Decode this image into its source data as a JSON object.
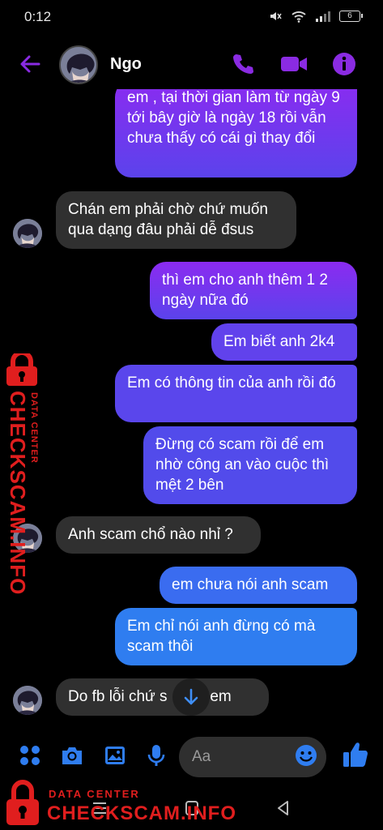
{
  "status_bar": {
    "time": "0:12",
    "battery": "6"
  },
  "header": {
    "contact_name": "Ngo"
  },
  "messages": [
    {
      "from": "me",
      "text": "em , tại thời gian làm từ ngày 9 tới bây giờ là ngày 18 rồi vẫn chưa thấy có cái gì thay đổi"
    },
    {
      "from": "them",
      "text": "Chán em phải chờ chứ muốn qua dạng đâu phải dễ đsus"
    },
    {
      "from": "me",
      "text": "thì em cho anh thêm 1 2 ngày nữa đó"
    },
    {
      "from": "me",
      "text": "Em biết anh 2k4"
    },
    {
      "from": "me",
      "text": "Em có thông tin của anh rồi đó"
    },
    {
      "from": "me",
      "text": "Đừng có scam rồi để em nhờ công an vào cuộc thì mệt 2 bên"
    },
    {
      "from": "them",
      "text": "Anh scam chổ nào nhỉ ?"
    },
    {
      "from": "me",
      "text": "em chưa nói anh scam"
    },
    {
      "from": "me",
      "text": "Em chỉ nói anh đừng có mà scam thôi"
    },
    {
      "from": "them",
      "text": "Do fb lỗi chứ s      gì em"
    }
  ],
  "composer": {
    "placeholder": "Aa"
  },
  "watermark": {
    "line1": "DATA CENTER",
    "line2": "CHECKSCAM.INFO"
  },
  "colors": {
    "accent": "#8a2be2",
    "outgoing_top": "#8b2bf0",
    "outgoing_bottom": "#2f7df0",
    "incoming": "#303030",
    "watermark": "#e01e1e"
  },
  "icons": [
    "back-arrow-icon",
    "phone-icon",
    "video-icon",
    "info-icon",
    "apps-icon",
    "camera-icon",
    "gallery-icon",
    "mic-icon",
    "emoji-icon",
    "thumbs-up-icon",
    "arrow-down-icon",
    "lock-icon"
  ]
}
